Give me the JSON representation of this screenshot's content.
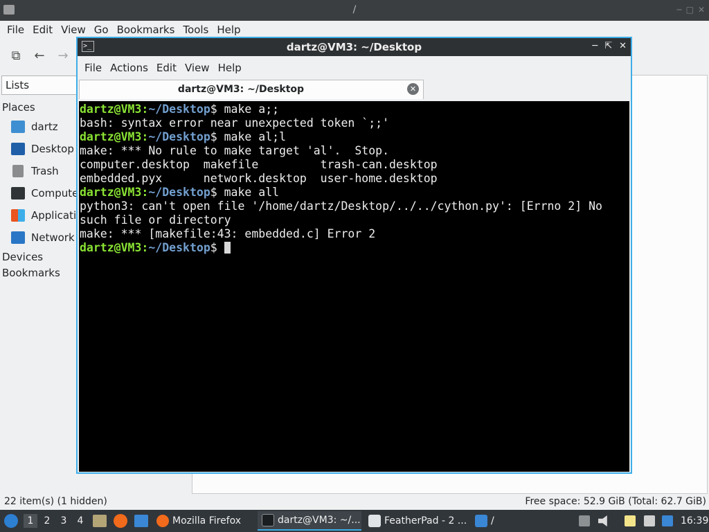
{
  "file_manager": {
    "title": "/",
    "menu": [
      "File",
      "Edit",
      "View",
      "Go",
      "Bookmarks",
      "Tools",
      "Help"
    ],
    "sidebar_header": "Lists",
    "places_heading": "Places",
    "places": [
      "dartz",
      "Desktop",
      "Trash",
      "Computer",
      "Applications",
      "Network"
    ],
    "devices_heading": "Devices",
    "bookmarks_heading": "Bookmarks",
    "status_left": "22 item(s) (1 hidden)",
    "status_right": "Free space: 52.9 GiB (Total: 62.7 GiB)"
  },
  "terminal": {
    "title": "dartz@VM3: ~/Desktop",
    "menu": [
      "File",
      "Actions",
      "Edit",
      "View",
      "Help"
    ],
    "tab_label": "dartz@VM3: ~/Desktop",
    "prompt_user": "dartz@VM3",
    "prompt_path": "~/Desktop",
    "lines": [
      {
        "type": "prompt",
        "cmd": " make a;;"
      },
      {
        "type": "out",
        "text": "bash: syntax error near unexpected token `;;'"
      },
      {
        "type": "prompt",
        "cmd": " make al;l"
      },
      {
        "type": "out",
        "text": "make: *** No rule to make target 'al'.  Stop."
      },
      {
        "type": "out",
        "text": "computer.desktop  makefile         trash-can.desktop"
      },
      {
        "type": "out",
        "text": "embedded.pyx      network.desktop  user-home.desktop"
      },
      {
        "type": "prompt",
        "cmd": " make all"
      },
      {
        "type": "out",
        "text": "python3: can't open file '/home/dartz/Desktop/../../cython.py': [Errno 2] No"
      },
      {
        "type": "out",
        "text": "such file or directory"
      },
      {
        "type": "out",
        "text": "make: *** [makefile:43: embedded.c] Error 2"
      },
      {
        "type": "prompt",
        "cmd": " ",
        "cursor": true
      }
    ]
  },
  "taskbar": {
    "desktops": [
      "1",
      "2",
      "3",
      "4"
    ],
    "active_desktop": "1",
    "tasks": {
      "firefox": "Mozilla Firefox",
      "terminal": "dartz@VM3: ~/...",
      "featherpad": "FeatherPad - 2 ...",
      "filemanager": "/"
    },
    "clock": "16:39"
  },
  "colors": {
    "accent": "#3daee9",
    "prompt_user": "#8ae234",
    "prompt_path": "#729fcf",
    "terminal_bg": "#000000",
    "taskbar_bg": "#31363b"
  }
}
